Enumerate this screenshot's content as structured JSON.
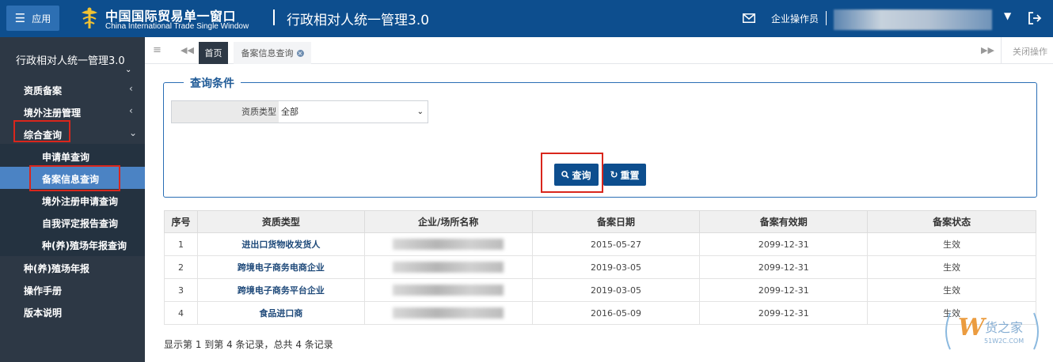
{
  "header": {
    "app_button_label": "应用",
    "brand_cn": "中国国际贸易单一窗口",
    "brand_en": "China International Trade Single Window",
    "system_title": "行政相对人统一管理3.0",
    "user_role": "企业操作员",
    "accent_color": "#0d4e8e"
  },
  "sidebar": {
    "title": "行政相对人统一管理3.0",
    "items": [
      {
        "label": "资质备案",
        "chevron": "‹"
      },
      {
        "label": "境外注册管理",
        "chevron": "‹"
      },
      {
        "label": "综合查询",
        "chevron": "⌄"
      }
    ],
    "sub_items": [
      {
        "label": "申请单查询"
      },
      {
        "label": "备案信息查询"
      },
      {
        "label": "境外注册申请查询"
      },
      {
        "label": "自我评定报告查询"
      },
      {
        "label": "种(养)殖场年报查询"
      }
    ],
    "bottom_items": [
      {
        "label": "种(养)殖场年报"
      },
      {
        "label": "操作手册"
      },
      {
        "label": "版本说明"
      }
    ]
  },
  "tabs": {
    "home": "首页",
    "active": "备案信息查询",
    "close_ops": "关闭操作"
  },
  "query": {
    "legend": "查询条件",
    "field_label": "资质类型",
    "field_value": "全部",
    "search_label": "查询",
    "reset_label": "重置"
  },
  "table": {
    "headers": [
      "序号",
      "资质类型",
      "企业/场所名称",
      "备案日期",
      "备案有效期",
      "备案状态"
    ],
    "rows": [
      {
        "no": "1",
        "type": "进出口货物收发货人",
        "date": "2015-05-27",
        "valid": "2099-12-31",
        "status": "生效"
      },
      {
        "no": "2",
        "type": "跨境电子商务电商企业",
        "date": "2019-03-05",
        "valid": "2099-12-31",
        "status": "生效"
      },
      {
        "no": "3",
        "type": "跨境电子商务平台企业",
        "date": "2019-03-05",
        "valid": "2099-12-31",
        "status": "生效"
      },
      {
        "no": "4",
        "type": "食品进口商",
        "date": "2016-05-09",
        "valid": "2099-12-31",
        "status": "生效"
      }
    ]
  },
  "pager": {
    "info": "显示第 1 到第 4 条记录，总共 4 条记录"
  },
  "watermark": {
    "text_cn": "货之家",
    "text_en": "51W2C.COM"
  }
}
